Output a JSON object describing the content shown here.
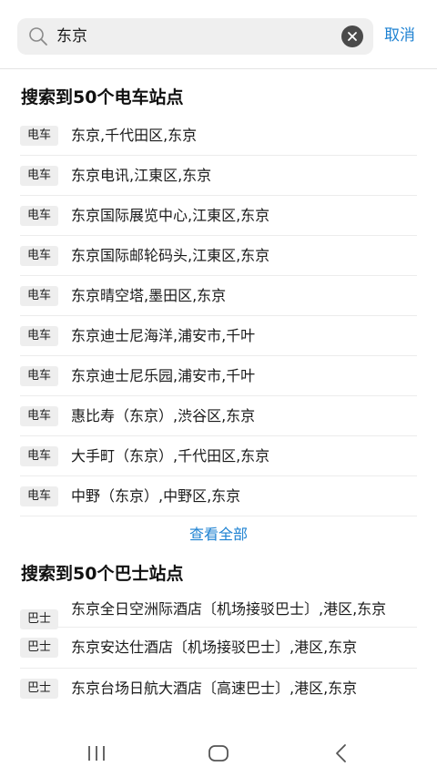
{
  "search": {
    "value": "东京",
    "cancel_label": "取消"
  },
  "train_section": {
    "title": "搜索到50个电车站点",
    "tag": "电车",
    "items": [
      "东京,千代田区,东京",
      "东京电讯,江東区,东京",
      "东京国际展览中心,江東区,东京",
      "东京国际邮轮码头,江東区,东京",
      "东京晴空塔,墨田区,东京",
      "东京迪士尼海洋,浦安市,千叶",
      "东京迪士尼乐园,浦安市,千叶",
      "惠比寿（东京）,渋谷区,东京",
      "大手町（东京）,千代田区,东京",
      "中野（东京）,中野区,东京"
    ],
    "view_all_label": "查看全部"
  },
  "bus_section": {
    "title": "搜索到50个巴士站点",
    "tag": "巴士",
    "items": [
      "东京全日空洲际酒店〔机场接驳巴士〕,港区,东京",
      "东京安达仕酒店〔机场接驳巴士〕,港区,东京",
      "东京台场日航大酒店〔高速巴士〕,港区,东京"
    ]
  },
  "icons": {
    "search": "search-icon",
    "clear": "clear-icon",
    "nav_recents": "recent-apps-icon",
    "nav_home": "home-icon",
    "nav_back": "back-icon"
  },
  "colors": {
    "accent": "#1e82d2",
    "tag_bg": "#eeeeee",
    "search_bg": "#efefef"
  }
}
